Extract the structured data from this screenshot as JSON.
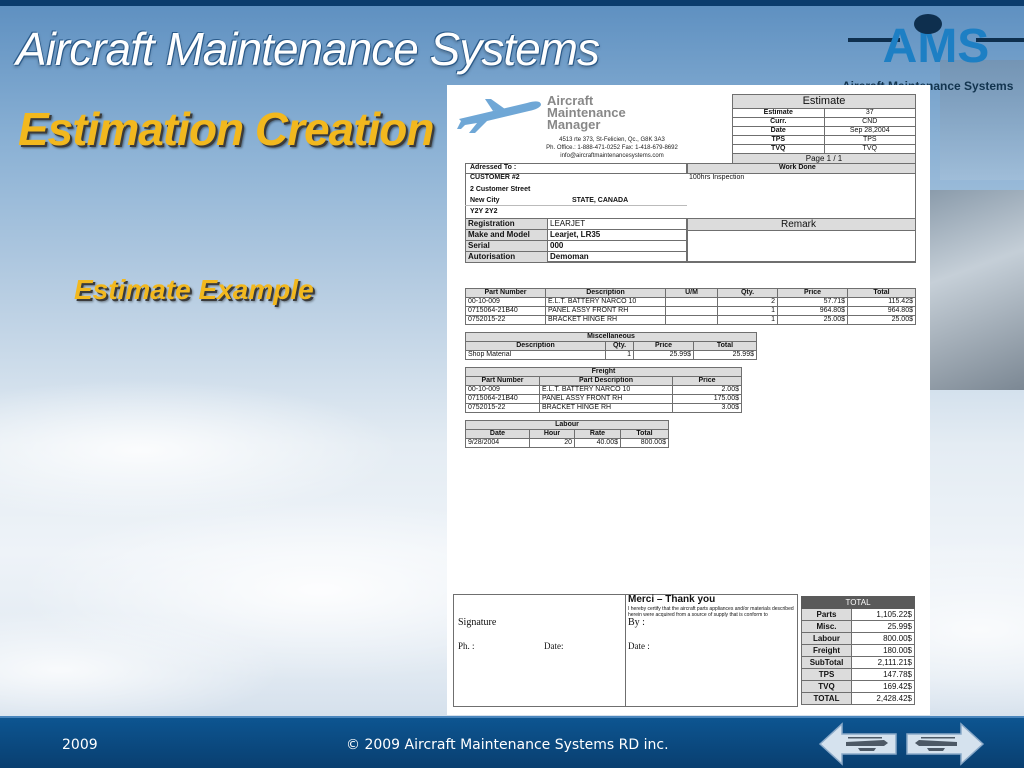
{
  "header": {
    "app_title": "Aircraft Maintenance Systems",
    "logo_text": "AMS",
    "logo_tagline": "Aircraft Maintenance Systems"
  },
  "slide": {
    "title": "Estimation Creation",
    "subtitle": "Estimate Example"
  },
  "doc": {
    "company": {
      "name": "Aircraft\nMaintenance\nManager",
      "address": "4513 rte 373, St-Felicien, Qc., G8K 3A3",
      "phone": "Ph. Office.: 1-888-471-0252   Fax: 1-418-679-8692",
      "email": "info@aircraftmaintenancesystems.com"
    },
    "estimate": {
      "title": "Estimate",
      "rows": [
        [
          "Estimate",
          "37"
        ],
        [
          "Curr.",
          "CND"
        ],
        [
          "Date",
          "Sep 28,2004"
        ],
        [
          "TPS",
          "TPS"
        ],
        [
          "TVQ",
          "TVQ"
        ]
      ],
      "page": "Page 1 / 1"
    },
    "addressed": {
      "label": "Adressed To :",
      "lines": [
        "CUSTOMER #2",
        "2 Customer Street",
        "New City",
        "Y2Y 2Y2"
      ],
      "state": "STATE, CANADA"
    },
    "work_done": {
      "label": "Work Done",
      "text": "100hrs Inspection"
    },
    "aircraft": [
      [
        "Registration",
        "LEARJET"
      ],
      [
        "Make and Model",
        "Learjet, LR35"
      ],
      [
        "Serial",
        "000"
      ],
      [
        "Autorisation",
        "Demoman"
      ]
    ],
    "remark": {
      "label": "Remark"
    },
    "parts": {
      "headers": [
        "Part Number",
        "Description",
        "U/M",
        "Qty.",
        "Price",
        "Total"
      ],
      "rows": [
        [
          "00-10-009",
          "E.L.T. BATTERY  NARCO 10",
          "",
          "2",
          "57.71$",
          "115.42$"
        ],
        [
          "0715064-21B40",
          "PANEL ASSY FRONT RH",
          "",
          "1",
          "964.80$",
          "964.80$"
        ],
        [
          "0752015-22",
          "BRACKET HINGE RH",
          "",
          "1",
          "25.00$",
          "25.00$"
        ]
      ]
    },
    "misc": {
      "title": "Miscellaneous",
      "headers": [
        "Description",
        "Qty.",
        "Price",
        "Total"
      ],
      "rows": [
        [
          "Shop Material",
          "1",
          "25.99$",
          "25.99$"
        ]
      ]
    },
    "freight": {
      "title": "Freight",
      "headers": [
        "Part Number",
        "Part Description",
        "Price"
      ],
      "rows": [
        [
          "00-10-009",
          "E.L.T. BATTERY  NARCO 10",
          "2.00$"
        ],
        [
          "0715064-21B40",
          "PANEL ASSY FRONT RH",
          "175.00$"
        ],
        [
          "0752015-22",
          "BRACKET HINGE RH",
          "3.00$"
        ]
      ]
    },
    "labour": {
      "title": "Labour",
      "headers": [
        "Date",
        "Hour",
        "Rate",
        "Total"
      ],
      "rows": [
        [
          "9/28/2004",
          "20",
          "40.00$",
          "800.00$"
        ]
      ]
    },
    "signature": {
      "label": "Signature",
      "ph": "Ph. :",
      "date1": "Date:",
      "by": "By :",
      "date2": "Date :",
      "thanks": "Merci – Thank you",
      "certify": "I hereby certify that the aircraft parts appliances and/or materials described herein were acquired from a source of supply that is conform to"
    },
    "totals": {
      "title": "TOTAL",
      "rows": [
        [
          "Parts",
          "1,105.22$"
        ],
        [
          "Misc.",
          "25.99$"
        ],
        [
          "Labour",
          "800.00$"
        ],
        [
          "Freight",
          "180.00$"
        ],
        [
          "SubTotal",
          "2,111.21$"
        ],
        [
          "TPS",
          "147.78$"
        ],
        [
          "TVQ",
          "169.42$"
        ],
        [
          "TOTAL",
          "2,428.42$"
        ]
      ]
    }
  },
  "footer": {
    "year": "2009",
    "copyright": "© 2009 Aircraft Maintenance Systems RD inc."
  },
  "nav": {
    "prev_icon": "prev-arrow-icon",
    "next_icon": "next-arrow-icon"
  },
  "colors": {
    "title_gold": "#f2b81e",
    "footer_blue": "#0b4a83"
  }
}
